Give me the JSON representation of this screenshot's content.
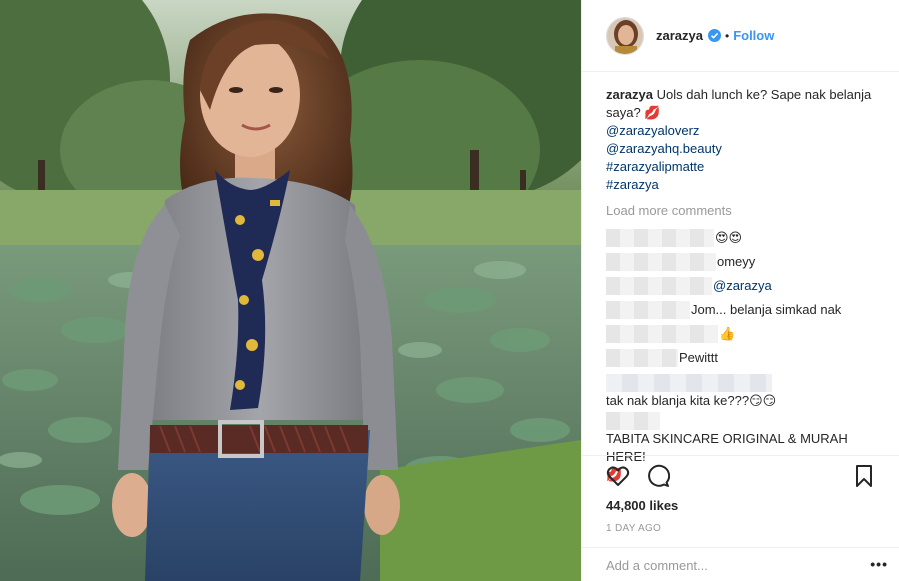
{
  "colors": {
    "link": "#3897f0",
    "mention": "#003569",
    "muted": "#999999",
    "border": "#efefef"
  },
  "header": {
    "username": "zarazya",
    "dot": "•",
    "follow_label": "Follow",
    "verified_icon": "verified-badge-icon"
  },
  "caption": {
    "username": "zarazya",
    "text": "Uols dah lunch ke? Sape nak belanja saya?",
    "emoji": "💋",
    "tags": [
      "@zarazyaloverz",
      "@zarazyahq.beauty",
      "#zarazyalipmatte",
      "#zarazya"
    ]
  },
  "load_more": "Load more comments",
  "comments": [
    {
      "text": "",
      "emoji": "😍😍"
    },
    {
      "text": "omeyy",
      "emoji": ""
    },
    {
      "text": "@zarazya",
      "emoji": ""
    },
    {
      "text": "Jom... belanja simkad nak",
      "emoji": ""
    },
    {
      "text": "",
      "emoji": "👍"
    },
    {
      "text": "Pewittt",
      "emoji": ""
    },
    {
      "text": "tak nak blanja kita ke???",
      "emoji": "😏😏"
    },
    {
      "text": "TABITA SKINCARE ORIGINAL & MURAH HERE!",
      "emoji": "💋"
    }
  ],
  "actions": {
    "like_icon": "heart-icon",
    "comment_icon": "comment-bubble-icon",
    "save_icon": "bookmark-icon"
  },
  "likes": "44,800 likes",
  "time_ago": "1 DAY AGO",
  "add_comment": {
    "placeholder": "Add a comment...",
    "more_label": "•••"
  }
}
